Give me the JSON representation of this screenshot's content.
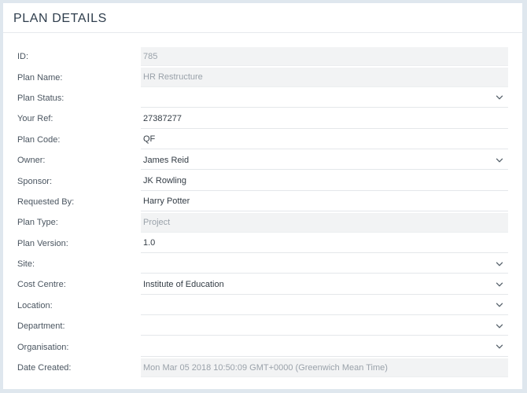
{
  "panel": {
    "title": "PLAN DETAILS"
  },
  "fields": [
    {
      "label": "ID:",
      "value": "785",
      "readonly": true,
      "dropdown": false
    },
    {
      "label": "Plan Name:",
      "value": "HR Restructure",
      "readonly": true,
      "dropdown": false
    },
    {
      "label": "Plan Status:",
      "value": "",
      "readonly": false,
      "dropdown": true
    },
    {
      "label": "Your Ref:",
      "value": "27387277",
      "readonly": false,
      "dropdown": false
    },
    {
      "label": "Plan Code:",
      "value": "QF",
      "readonly": false,
      "dropdown": false
    },
    {
      "label": "Owner:",
      "value": "James Reid",
      "readonly": false,
      "dropdown": true
    },
    {
      "label": "Sponsor:",
      "value": "JK Rowling",
      "readonly": false,
      "dropdown": false
    },
    {
      "label": "Requested By:",
      "value": "Harry Potter",
      "readonly": false,
      "dropdown": false
    },
    {
      "label": "Plan Type:",
      "value": "Project",
      "readonly": true,
      "dropdown": false
    },
    {
      "label": "Plan Version:",
      "value": "1.0",
      "readonly": false,
      "dropdown": false
    },
    {
      "label": "Site:",
      "value": "",
      "readonly": false,
      "dropdown": true
    },
    {
      "label": "Cost Centre:",
      "value": "Institute of Education",
      "readonly": false,
      "dropdown": true
    },
    {
      "label": "Location:",
      "value": "",
      "readonly": false,
      "dropdown": true
    },
    {
      "label": "Department:",
      "value": "",
      "readonly": false,
      "dropdown": true
    },
    {
      "label": "Organisation:",
      "value": "",
      "readonly": false,
      "dropdown": true
    },
    {
      "label": "Date Created:",
      "value": "Mon Mar 05 2018 10:50:09 GMT+0000 (Greenwich Mean Time)",
      "readonly": true,
      "dropdown": false
    }
  ],
  "icons": {
    "dropdown": "chevron-down-icon"
  },
  "colors": {
    "title": "#2f3e4d",
    "label": "#4a5560",
    "readonly_bg": "#f2f3f4",
    "readonly_text": "#9aa2aa",
    "chevron": "#56616b"
  }
}
